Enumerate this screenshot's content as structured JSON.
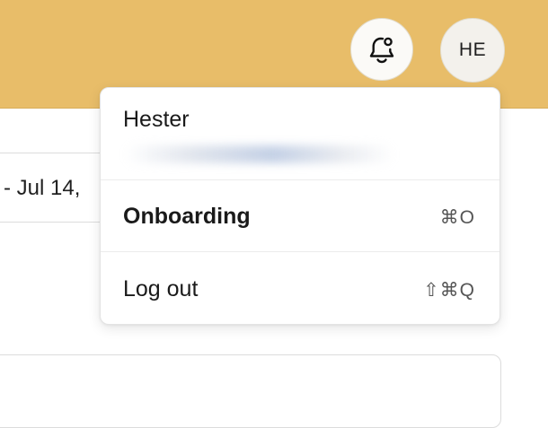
{
  "header": {
    "background_color": "#e8bd69",
    "notification_icon": "bell-icon",
    "avatar_initials": "HE"
  },
  "page": {
    "date_range_text": "- Jul 14,"
  },
  "user_menu": {
    "user_name": "Hester",
    "items": [
      {
        "label": "Onboarding",
        "shortcut": "⌘O"
      },
      {
        "label": "Log out",
        "shortcut": "⇧⌘Q"
      }
    ]
  }
}
